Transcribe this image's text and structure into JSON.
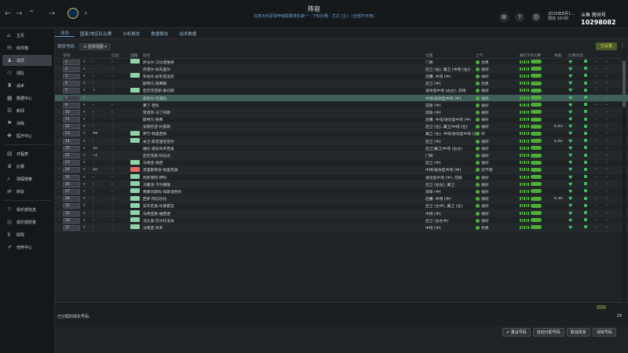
{
  "header": {
    "title": "阵容",
    "subtitle": "在意大利足球甲级联赛排名第一 · 下轮比赛 · 尤文 (主) · (全部不可用)",
    "date": "2020年8月1...",
    "time": "周日 10:00",
    "stream_logo": "斗鱼 房间号",
    "stream_room": "10298082"
  },
  "sidebar": {
    "items": [
      {
        "label": "主页",
        "icon": "home-icon"
      },
      {
        "label": "收件箱",
        "icon": "inbox-icon"
      },
      {
        "label": "球员",
        "icon": "players-icon",
        "active": true
      },
      {
        "label": "球队",
        "icon": "team-icon"
      },
      {
        "label": "战术",
        "icon": "tactics-icon"
      },
      {
        "label": "数据中心",
        "icon": "data-icon"
      },
      {
        "label": "新闻",
        "icon": "news-icon"
      },
      {
        "label": "训练",
        "icon": "training-icon"
      },
      {
        "label": "医疗中心",
        "icon": "medical-icon"
      },
      {
        "label": "日程表",
        "icon": "calendar-icon"
      },
      {
        "label": "比赛",
        "icon": "competitions-icon"
      },
      {
        "label": "球探搜索",
        "icon": "scouting-icon"
      },
      {
        "label": "转会",
        "icon": "transfers-icon"
      },
      {
        "label": "俱乐部信息",
        "icon": "club-info-icon"
      },
      {
        "label": "俱乐部愿景",
        "icon": "vision-icon"
      },
      {
        "label": "财政",
        "icon": "finance-icon"
      },
      {
        "label": "培养中心",
        "icon": "development-icon"
      }
    ]
  },
  "tabs": [
    {
      "label": "球员",
      "active": true
    },
    {
      "label": "国家/地区队比赛"
    },
    {
      "label": "分析报告"
    },
    {
      "label": "数据报告"
    },
    {
      "label": "战术数据"
    }
  ],
  "filter": {
    "label": "球员号码",
    "view": "选择视图"
  },
  "tactic_badge": "已设置",
  "columns": [
    "号码",
    "",
    "信息",
    "国籍",
    "姓名",
    "位置",
    "士气",
    "最近5场比赛",
    "体能",
    "比赛状态"
  ],
  "rows": [
    {
      "num": "1",
      "a": "-",
      "b": "-",
      "tag": "#8fd3a6",
      "name": "萨米尔·汉达诺维奇",
      "pos": "门将",
      "mor": "优秀",
      "mc": "#4fae3a",
      "fit": ""
    },
    {
      "num": "2",
      "a": "-",
      "b": "-",
      "tag": "",
      "name": "丹诺尔·加布里尔",
      "pos": "后卫 (右), 翼卫 (中场 (右))",
      "mor": "很好",
      "mc": "#4fae3a",
      "fit": ""
    },
    {
      "num": "3",
      "a": "-",
      "b": "-",
      "tag": "#8fd3a6",
      "name": "罗伯托·加利亚迪尼",
      "pos": "后腰, 中场 (中)",
      "mor": "很好",
      "mc": "#4fae3a",
      "fit": ""
    },
    {
      "num": "4",
      "a": "-",
      "b": "-",
      "tag": "",
      "name": "斯特凡·德弗赖",
      "pos": "后卫 (中)",
      "mor": "优秀",
      "mc": "#4fae3a",
      "fit": ""
    },
    {
      "num": "5",
      "a": "7",
      "b": "-",
      "tag": "#8fd3a6",
      "name": "亚历克西斯·桑切斯",
      "pos": "进攻型中场 (右左), 前锋",
      "mor": "很好",
      "mc": "#4fae3a",
      "fit": ""
    },
    {
      "num": "5",
      "a": "-",
      "b": "-",
      "tag": "",
      "name": "皮科尔·巴雷拉",
      "pos": "中场/进攻型中场 (中)",
      "mor": "很好",
      "mc": "#4fae3a",
      "fit": "",
      "sel": true
    },
    {
      "num": "9",
      "a": "-",
      "b": "-",
      "tag": "",
      "name": "黄丁·普科",
      "pos": "前锋 (中)",
      "mor": "很好",
      "mc": "#4fae3a",
      "fit": ""
    },
    {
      "num": "10",
      "a": "-",
      "b": "-",
      "tag": "",
      "name": "劳塔罗·马丁内斯",
      "pos": "前锋 (中)",
      "mor": "很好",
      "mc": "#4fae3a",
      "fit": ""
    },
    {
      "num": "11",
      "a": "-",
      "b": "-",
      "tag": "",
      "name": "斯特凡·德弗",
      "pos": "后腰, 中场/进攻型中场 (中)",
      "mor": "很好",
      "mc": "#4fae3a",
      "fit": ""
    },
    {
      "num": "12",
      "a": "-",
      "b": "-",
      "tag": "",
      "name": "安德烈亚·托雷斯",
      "pos": "后卫 (左), 翼卫/中场 (左)",
      "mor": "很好",
      "mc": "#4fae3a",
      "fit": "6.83"
    },
    {
      "num": "13",
      "a": "44",
      "b": "-",
      "tag": "#8fd3a6",
      "name": "伊万·佩里西奇",
      "pos": "翼卫 (左), 中场/进攻型中场 (左)",
      "mor": "好",
      "mc": "#4fae3a",
      "fit": ""
    },
    {
      "num": "14",
      "a": "-",
      "b": "-",
      "tag": "#8fd3a6",
      "name": "米兰·斯克里尼亚尔",
      "pos": "后卫 (中)",
      "mor": "很好",
      "mc": "#4fae3a",
      "fit": "6.80"
    },
    {
      "num": "15",
      "a": "10",
      "b": "-",
      "tag": "",
      "name": "维托·德安布罗西奥",
      "pos": "后卫/翼卫/中场 (右左)",
      "mor": "很好",
      "mc": "#4fae3a",
      "fit": ""
    },
    {
      "num": "21",
      "a": "71",
      "b": "-",
      "tag": "",
      "name": "亚历克斯·科拉达",
      "pos": "门将",
      "mor": "很好",
      "mc": "#4fae3a",
      "fit": ""
    },
    {
      "num": "23",
      "a": "-",
      "b": "-",
      "tag": "#8fd3a6",
      "name": "马蒂亚·德西",
      "pos": "后卫 (中)",
      "mor": "很好",
      "mc": "#4fae3a",
      "fit": ""
    },
    {
      "num": "24",
      "a": "10",
      "b": "-",
      "tag": "#e66b6b",
      "name": "克里斯蒂安·埃里克森",
      "pos": "中场/进攻型中场 (中)",
      "mor": "还不错",
      "mc": "#4fae3a",
      "fit": ""
    },
    {
      "num": "25",
      "a": "-",
      "b": "-",
      "tag": "#8fd3a6",
      "name": "阿萨莫阿·伊利",
      "pos": "进攻型中场 (中), 前锋",
      "mor": "很好",
      "mc": "#4fae3a",
      "fit": ""
    },
    {
      "num": "26",
      "a": "-",
      "b": "-",
      "tag": "#8fd3a6",
      "name": "马塞洛·卡尔德隆",
      "pos": "后卫 (右左), 翼卫",
      "mor": "很好",
      "mc": "#4fae3a",
      "fit": ""
    },
    {
      "num": "27",
      "a": "-",
      "b": "-",
      "tag": "#8fd3a6",
      "name": "弗朗切斯科·埃斯波西托",
      "pos": "前锋 (中)",
      "mor": "很好",
      "mc": "#4fae3a",
      "fit": ""
    },
    {
      "num": "28",
      "a": "-",
      "b": "-",
      "tag": "#8fd3a6",
      "name": "西罗·阿切尔比",
      "pos": "后腰, 中场 (中)",
      "mor": "很好",
      "mc": "#4fae3a",
      "fit": "6.90"
    },
    {
      "num": "31",
      "a": "-",
      "b": "-",
      "tag": "#8fd3a6",
      "name": "安东尼奥·坎德雷瓦",
      "pos": "后卫 (左中), 翼卫 (左)",
      "mor": "很好",
      "mc": "#4fae3a",
      "fit": ""
    },
    {
      "num": "32",
      "a": "-",
      "b": "-",
      "tag": "#8fd3a6",
      "name": "马蒂亚斯·维西诺",
      "pos": "中场 (中)",
      "mor": "很好",
      "mc": "#4fae3a",
      "fit": ""
    },
    {
      "num": "33",
      "a": "-",
      "b": "-",
      "tag": "#8fd3a6",
      "name": "法比奥·巴尔托洛米",
      "pos": "后卫 (右左中)",
      "mor": "很好",
      "mc": "#4fae3a",
      "fit": ""
    },
    {
      "num": "37",
      "a": "-",
      "b": "-",
      "tag": "#8fd3a6",
      "name": "马蒂亚·布罗",
      "pos": "中场 (中)",
      "mor": "优秀",
      "mc": "#4fae3a",
      "fit": ""
    }
  ],
  "footer": {
    "label": "已分配的球衣号码:",
    "count": "29"
  },
  "actions": [
    "✔ 重设号码",
    "自动分配号码",
    "取消改变",
    "清除号码"
  ]
}
